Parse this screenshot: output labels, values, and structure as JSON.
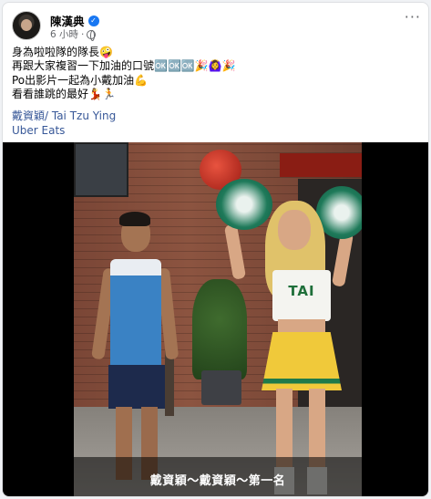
{
  "post": {
    "author": "陳漢典",
    "time": "6 小時",
    "dot": "·",
    "lines": [
      "身為啦啦隊的隊長🤪",
      "再跟大家複習一下加油的口號🆗🆗🆗🎉🙆‍♀️🎉",
      "Po出影片一起為小戴加油💪",
      "看看誰跳的最好💃🏃"
    ],
    "links": [
      "戴資穎/ Tai Tzu Ying",
      "Uber Eats"
    ],
    "more_label": "···"
  },
  "video": {
    "jersey_text": "TAI",
    "subtitle": "戴資穎～戴資穎～第一名"
  },
  "icons": {
    "verified": "verified-badge-icon",
    "privacy": "globe-icon",
    "more": "more-options-icon"
  },
  "colors": {
    "link": "#385898",
    "verified": "#1877f2",
    "meta": "#65676b"
  }
}
